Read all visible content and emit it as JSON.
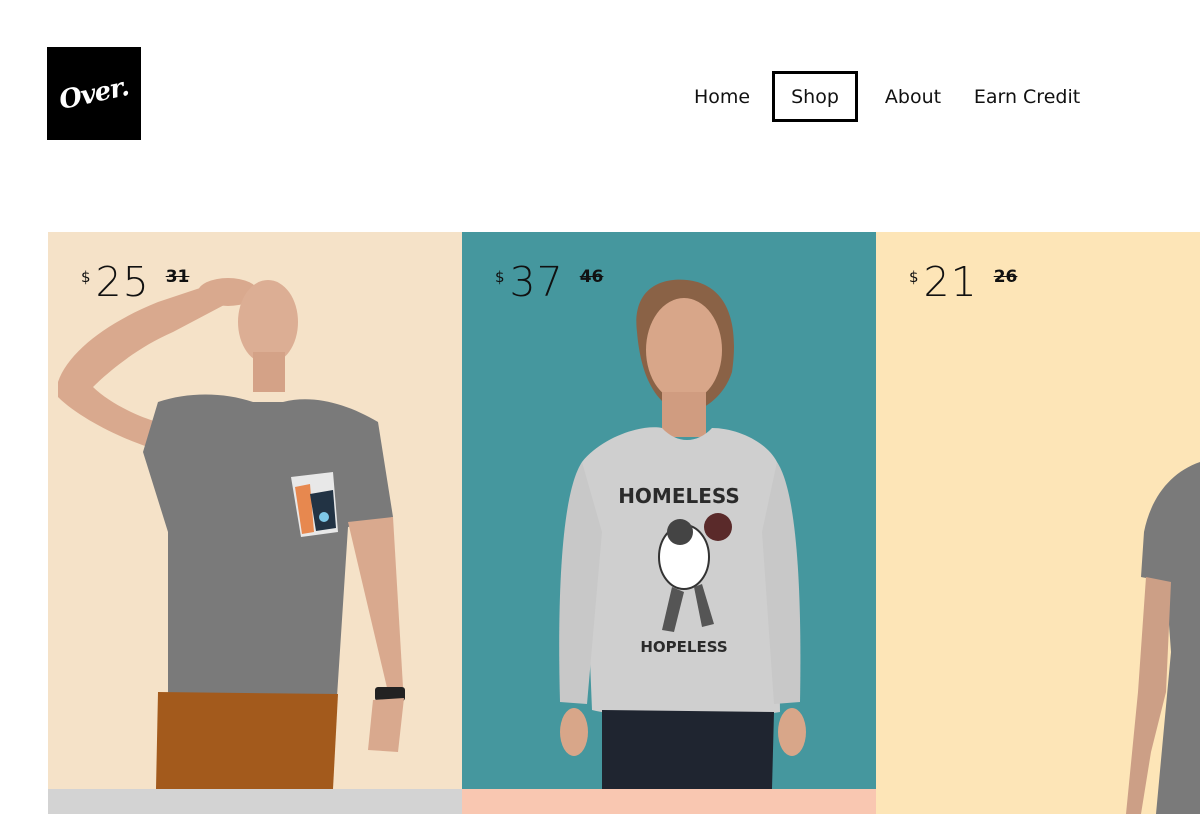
{
  "brand": {
    "logo_text": "Over."
  },
  "nav": {
    "items": [
      {
        "label": "Home"
      },
      {
        "label": "Shop",
        "active": true
      },
      {
        "label": "About"
      },
      {
        "label": "Earn Credit"
      }
    ]
  },
  "products": [
    {
      "currency": "$",
      "price": "25",
      "old_price": "31",
      "bg_color": "#f5e2c8",
      "item": "grey t-shirt with patterned pocket"
    },
    {
      "currency": "$",
      "price": "37",
      "old_price": "46",
      "bg_color": "#45979e",
      "item": "grey sweatshirt"
    },
    {
      "currency": "$",
      "price": "21",
      "old_price": "26",
      "bg_color": "#fde5b7",
      "item": "grey t-shirt"
    }
  ],
  "next_row_colors": [
    "#d3d3d3",
    "#f9c7b1"
  ],
  "colors": {
    "text": "#111111",
    "active_border": "#000000",
    "logo_bg": "#000000"
  }
}
